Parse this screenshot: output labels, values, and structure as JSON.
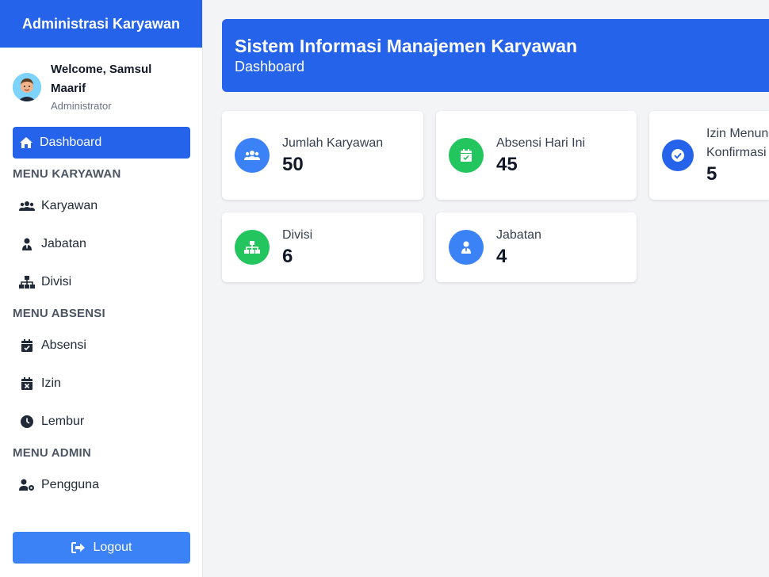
{
  "sidebar": {
    "brand": "Administrasi Karyawan",
    "user": {
      "welcome": "Welcome, Samsul Maarif",
      "role": "Administrator"
    },
    "active_item": {
      "label": "Dashboard",
      "icon": "home-icon"
    },
    "sections": [
      {
        "title": "MENU KARYAWAN",
        "items": [
          {
            "label": "Karyawan",
            "icon": "users-icon"
          },
          {
            "label": "Jabatan",
            "icon": "user-tie-icon"
          },
          {
            "label": "Divisi",
            "icon": "sitemap-icon"
          }
        ]
      },
      {
        "title": "MENU ABSENSI",
        "items": [
          {
            "label": "Absensi",
            "icon": "calendar-check-icon"
          },
          {
            "label": "Izin",
            "icon": "calendar-x-icon"
          },
          {
            "label": "Lembur",
            "icon": "clock-icon"
          }
        ]
      },
      {
        "title": "MENU ADMIN",
        "items": [
          {
            "label": "Pengguna",
            "icon": "user-gear-icon"
          }
        ]
      }
    ],
    "logout": "Logout"
  },
  "header": {
    "title": "Sistem Informasi Manajemen Karyawan",
    "subtitle": "Dashboard"
  },
  "cards": [
    {
      "label": "Jumlah Karyawan",
      "value": "50",
      "color": "#3b82f6",
      "icon": "users-icon"
    },
    {
      "label": "Absensi Hari Ini",
      "value": "45",
      "color": "#22c55e",
      "icon": "calendar-check-icon"
    },
    {
      "label": "Izin Menunggu Konfirmasi",
      "value": "5",
      "color": "#2563eb",
      "icon": "check-circle-icon"
    },
    {
      "label": "Divisi",
      "value": "6",
      "color": "#22c55e",
      "icon": "sitemap-icon"
    },
    {
      "label": "Jabatan",
      "value": "4",
      "color": "#3b82f6",
      "icon": "user-tie-icon"
    }
  ],
  "colors": {
    "primary": "#2563eb",
    "primary_light": "#3b82f6",
    "success": "#22c55e"
  }
}
